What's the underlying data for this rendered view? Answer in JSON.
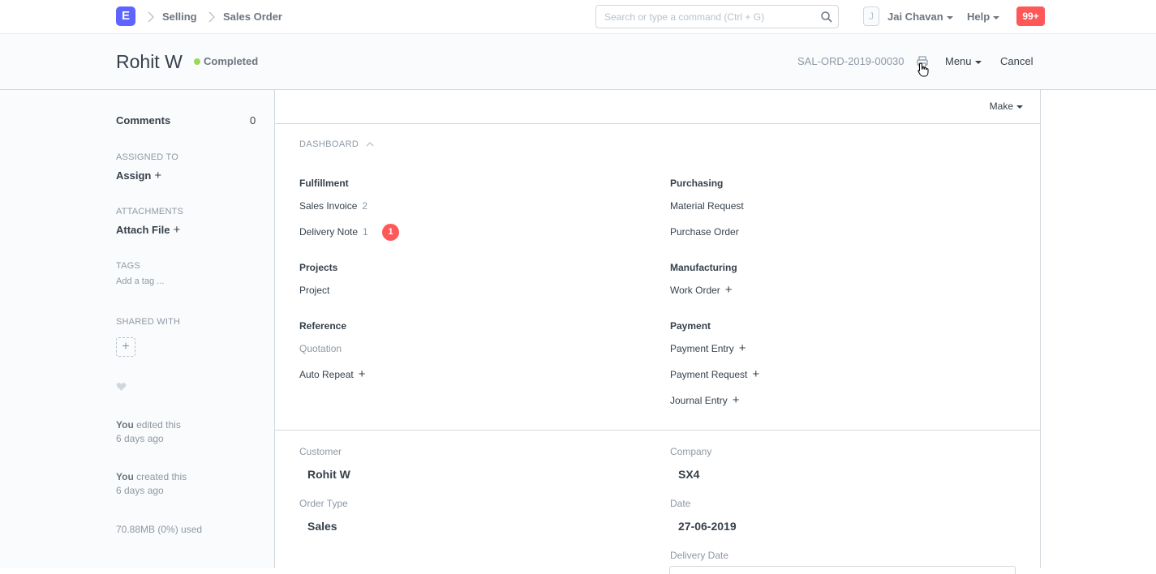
{
  "navbar": {
    "logo_letter": "E",
    "breadcrumbs": [
      "Selling",
      "Sales Order"
    ],
    "search_placeholder": "Search or type a command (Ctrl + G)",
    "avatar_letter": "J",
    "user_name": "Jai Chavan",
    "help_label": "Help",
    "notifications": "99+"
  },
  "page_head": {
    "title": "Rohit W",
    "status": "Completed",
    "doc_name": "SAL-ORD-2019-00030",
    "menu_label": "Menu",
    "cancel_label": "Cancel"
  },
  "sidebar": {
    "comments_label": "Comments",
    "comments_count": "0",
    "assigned_label": "ASSIGNED TO",
    "assign_action": "Assign",
    "attachments_label": "ATTACHMENTS",
    "attach_action": "Attach File",
    "tags_label": "TAGS",
    "tag_placeholder": "Add a tag ...",
    "shared_label": "SHARED WITH",
    "activity": [
      {
        "who": "You",
        "what": " edited this",
        "when": "6 days ago"
      },
      {
        "who": "You",
        "what": " created this",
        "when": "6 days ago"
      }
    ],
    "usage": "70.88MB (0%) used"
  },
  "main": {
    "make_label": "Make",
    "dashboard_label": "DASHBOARD",
    "groups": {
      "fulfillment": {
        "title": "Fulfillment",
        "sales_invoice": "Sales Invoice",
        "sales_invoice_count": "2",
        "delivery_note": "Delivery Note",
        "delivery_note_count": "1",
        "delivery_note_badge": "1"
      },
      "purchasing": {
        "title": "Purchasing",
        "material_request": "Material Request",
        "purchase_order": "Purchase Order"
      },
      "projects": {
        "title": "Projects",
        "project": "Project"
      },
      "manufacturing": {
        "title": "Manufacturing",
        "work_order": "Work Order"
      },
      "reference": {
        "title": "Reference",
        "quotation": "Quotation",
        "auto_repeat": "Auto Repeat"
      },
      "payment": {
        "title": "Payment",
        "payment_entry": "Payment Entry",
        "payment_request": "Payment Request",
        "journal_entry": "Journal Entry"
      }
    },
    "fields": {
      "customer_label": "Customer",
      "customer_value": "Rohit W",
      "company_label": "Company",
      "company_value": "SX4",
      "order_type_label": "Order Type",
      "order_type_value": "Sales",
      "date_label": "Date",
      "date_value": "27-06-2019",
      "delivery_date_label": "Delivery Date"
    }
  }
}
